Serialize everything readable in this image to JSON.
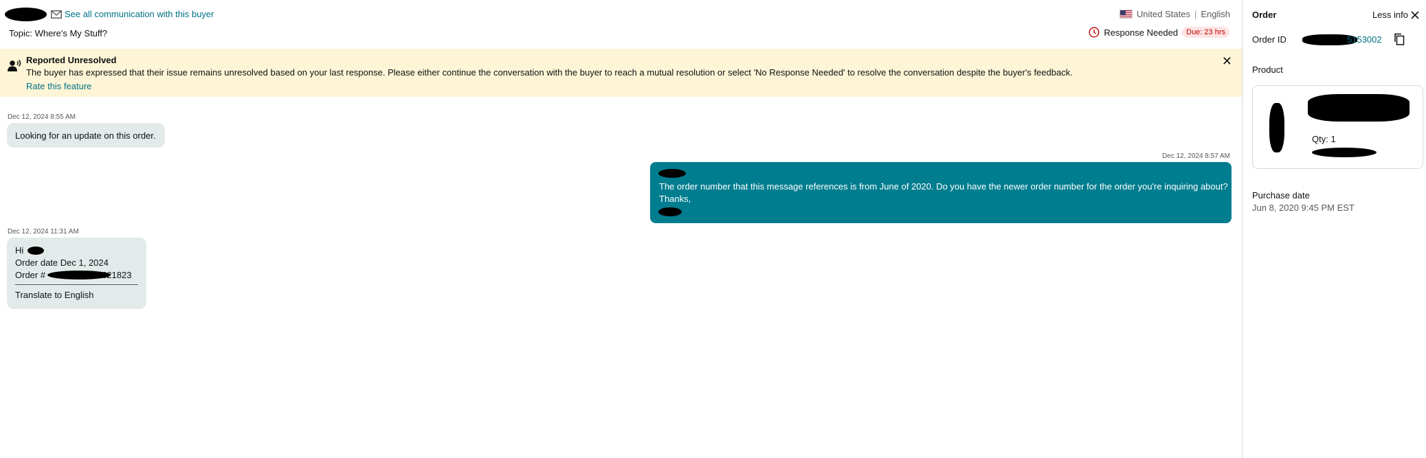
{
  "header": {
    "see_all_label": "See all communication with this buyer",
    "locale_country": "United States",
    "locale_separator": "|",
    "locale_language": "English",
    "topic": "Topic: Where's My Stuff?",
    "response_needed": "Response Needed",
    "due_badge": "Due: 23 hrs"
  },
  "banner": {
    "title": "Reported Unresolved",
    "text": "The buyer has expressed that their issue remains unresolved based on your last response. Please either continue the conversation with the buyer to reach a mutual resolution or select 'No Response Needed' to resolve the conversation despite the buyer's feedback.",
    "link": "Rate this feature",
    "close": "✕"
  },
  "messages": [
    {
      "timestamp": "Dec 12, 2024 8:55 AM",
      "text": "Looking for an update on this order."
    },
    {
      "timestamp": "Dec 12, 2024 8:57 AM",
      "line1": "The order number that this message references is from June of 2020. Do you have the newer order number for the order you're inquiring about?",
      "line2": "Thanks,"
    },
    {
      "timestamp": "Dec 12, 2024 11:31 AM",
      "greeting": "Hi",
      "order_date": "Order date Dec 1, 2024",
      "order_prefix": "Order #",
      "order_suffix": "621823",
      "translate": "Translate to English"
    }
  ],
  "sidebar": {
    "title": "Order",
    "less_info": "Less info",
    "order_id_label": "Order ID",
    "order_id_suffix": "5153002",
    "product_label": "Product",
    "qty": "Qty: 1",
    "purchase_date_label": "Purchase date",
    "purchase_date": "Jun 8, 2020 9:45 PM EST"
  },
  "colors": {
    "accent_link": "#007185",
    "outgoing_bubble": "#007d8f",
    "incoming_bubble": "#e3eaea",
    "banner_bg": "#fef5d6",
    "due_badge_bg": "#fde4e4"
  }
}
